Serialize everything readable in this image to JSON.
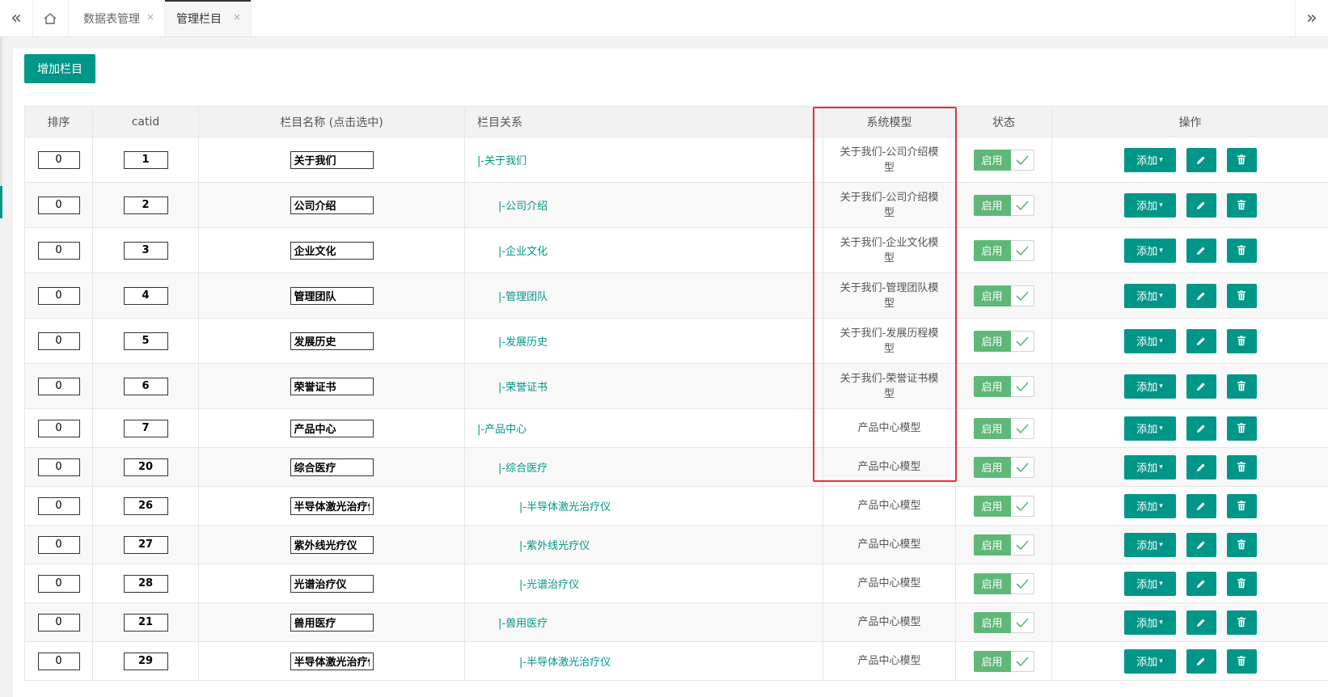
{
  "tabs": [
    {
      "label": "数据表管理",
      "close": "×",
      "active": false
    },
    {
      "label": "管理栏目",
      "close": "×",
      "active": true
    }
  ],
  "toolbar": {
    "add_label": "增加栏目"
  },
  "table": {
    "headers": [
      "排序",
      "catid",
      "栏目名称 (点击选中)",
      "栏目关系",
      "系统模型",
      "状态",
      "操作"
    ],
    "rows": [
      {
        "sort": "0",
        "catid": "1",
        "name": "关于我们",
        "relation": "|-关于我们",
        "level": 0,
        "model": "关于我们-公司介绍模型",
        "status": "启用"
      },
      {
        "sort": "0",
        "catid": "2",
        "name": "公司介绍",
        "relation": "|-公司介绍",
        "level": 1,
        "model": "关于我们-公司介绍模型",
        "status": "启用"
      },
      {
        "sort": "0",
        "catid": "3",
        "name": "企业文化",
        "relation": "|-企业文化",
        "level": 1,
        "model": "关于我们-企业文化模型",
        "status": "启用"
      },
      {
        "sort": "0",
        "catid": "4",
        "name": "管理团队",
        "relation": "|-管理团队",
        "level": 1,
        "model": "关于我们-管理团队模型",
        "status": "启用"
      },
      {
        "sort": "0",
        "catid": "5",
        "name": "发展历史",
        "relation": "|-发展历史",
        "level": 1,
        "model": "关于我们-发展历程模型",
        "status": "启用"
      },
      {
        "sort": "0",
        "catid": "6",
        "name": "荣誉证书",
        "relation": "|-荣誉证书",
        "level": 1,
        "model": "关于我们-荣誉证书模型",
        "status": "启用"
      },
      {
        "sort": "0",
        "catid": "7",
        "name": "产品中心",
        "relation": "|-产品中心",
        "level": 0,
        "model": "产品中心模型",
        "status": "启用"
      },
      {
        "sort": "0",
        "catid": "20",
        "name": "综合医疗",
        "relation": "|-综合医疗",
        "level": 1,
        "model": "产品中心模型",
        "status": "启用"
      },
      {
        "sort": "0",
        "catid": "26",
        "name": "半导体激光治疗仪",
        "relation": "|-半导体激光治疗仪",
        "level": 2,
        "model": "产品中心模型",
        "status": "启用"
      },
      {
        "sort": "0",
        "catid": "27",
        "name": "紫外线光疗仪",
        "relation": "|-紫外线光疗仪",
        "level": 2,
        "model": "产品中心模型",
        "status": "启用"
      },
      {
        "sort": "0",
        "catid": "28",
        "name": "光谱治疗仪",
        "relation": "|-光谱治疗仪",
        "level": 2,
        "model": "产品中心模型",
        "status": "启用"
      },
      {
        "sort": "0",
        "catid": "21",
        "name": "兽用医疗",
        "relation": "|-兽用医疗",
        "level": 1,
        "model": "产品中心模型",
        "status": "启用"
      },
      {
        "sort": "0",
        "catid": "29",
        "name": "半导体激光治疗仪",
        "relation": "|-半导体激光治疗仪",
        "level": 2,
        "model": "产品中心模型",
        "status": "启用"
      }
    ],
    "ops": {
      "add_label": "添加",
      "add_caret": "▾",
      "edit_icon": "pencil-icon",
      "delete_icon": "trash-icon"
    }
  },
  "colors": {
    "primary": "#009688",
    "switch_on": "#5fb878",
    "highlight_box": "#e0333a"
  }
}
